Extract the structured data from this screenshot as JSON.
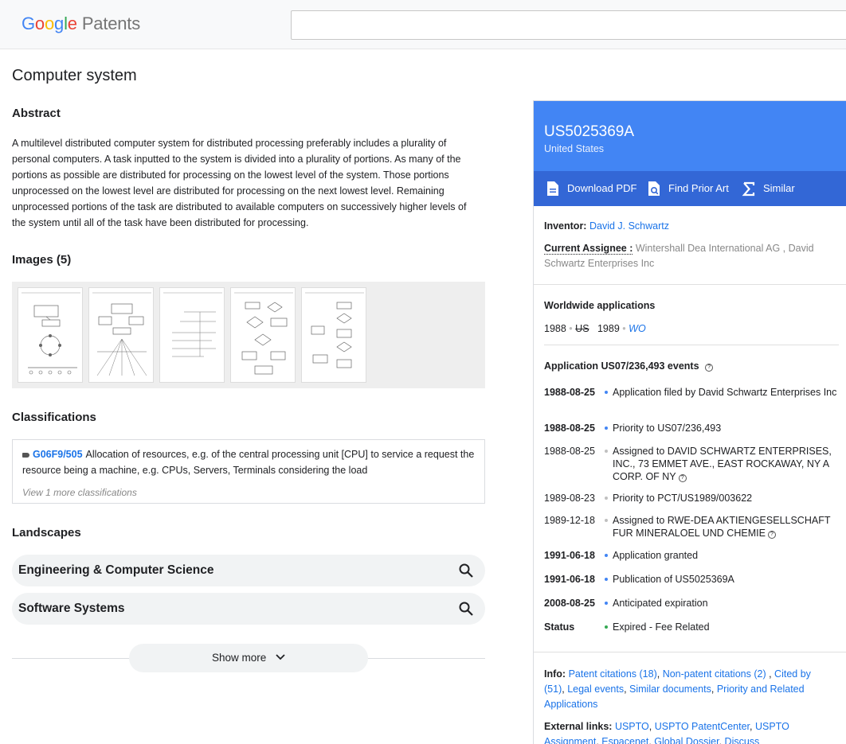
{
  "header": {
    "logo_google": [
      "G",
      "o",
      "o",
      "g",
      "l",
      "e"
    ],
    "logo_product": "Patents",
    "search_value": ""
  },
  "main": {
    "title": "Computer system",
    "abstract_heading": "Abstract",
    "abstract_text": "A multilevel distributed computer system for distributed processing preferably includes a plurality of personal computers. A task inputted to the system is divided into a plurality of portions. As many of the portions as possible are distributed for processing on the lowest level of the system. Those portions unprocessed on the lowest level are distributed for processing on the next lowest level. Remaining unprocessed portions of the task are distributed to available computers on successively higher levels of the system until all of the task have been distributed for processing.",
    "images_heading": "Images (5)",
    "classifications_heading": "Classifications",
    "classification": {
      "code": "G06F9/505",
      "description": "Allocation of resources, e.g. of the central processing unit [CPU] to service a request the resource being a machine, e.g. CPUs, Servers, Terminals considering the load",
      "more": "View 1 more classifications"
    },
    "landscapes_heading": "Landscapes",
    "landscapes": [
      "Engineering & Computer Science",
      "Software Systems"
    ],
    "show_more": "Show more"
  },
  "side": {
    "patent_number": "US5025369A",
    "country": "United States",
    "actions": [
      "Download PDF",
      "Find Prior Art",
      "Similar"
    ],
    "inventor_label": "Inventor:",
    "inventor": "David J. Schwartz",
    "assignee_label": "Current Assignee :",
    "assignee": "Wintershall Dea International AG , David Schwartz Enterprises Inc",
    "worldwide_heading": "Worldwide applications",
    "worldwide": [
      {
        "year": "1988",
        "code": "US"
      },
      {
        "year": "1989",
        "code": "WO"
      }
    ],
    "events_heading": "Application US07/236,493 events",
    "events": [
      {
        "date": "1988-08-25",
        "text": "Application filed by David Schwartz Enterprises Inc",
        "bold": true
      },
      {
        "date": "1988-08-25",
        "text": "Priority to US07/236,493",
        "bold": true
      },
      {
        "date": "1988-08-25",
        "text": "Assigned to DAVID SCHWARTZ ENTERPRISES, INC., 73 EMMET AVE., EAST ROCKAWAY, NY A CORP. OF NY",
        "bold": false
      },
      {
        "date": "1989-08-23",
        "text": "Priority to PCT/US1989/003622",
        "bold": false
      },
      {
        "date": "1989-12-18",
        "text": "Assigned to RWE-DEA AKTIENGESELLSCHAFT FUR MINERALOEL UND CHEMIE",
        "bold": false
      },
      {
        "date": "1991-06-18",
        "text": "Application granted",
        "bold": true
      },
      {
        "date": "1991-06-18",
        "text": "Publication of US5025369A",
        "bold": true
      },
      {
        "date": "2008-08-25",
        "text": "Anticipated expiration",
        "bold": true
      },
      {
        "date": "Status",
        "text": "Expired - Fee Related",
        "bold": true
      }
    ],
    "info_label": "Info:",
    "info_links": [
      "Patent citations (18)",
      "Non-patent citations (2)",
      "Cited by (51)",
      "Legal events",
      "Similar documents",
      "Priority and Related Applications"
    ],
    "external_label": "External links:",
    "external_links": [
      "USPTO",
      "USPTO PatentCenter",
      "USPTO Assignment",
      "Espacenet",
      "Global Dossier",
      "Discuss"
    ]
  },
  "colors": {
    "accent": "#4285f4",
    "accent_dark": "#3367d6",
    "link": "#1a73e8",
    "status_green": "#34a853"
  }
}
